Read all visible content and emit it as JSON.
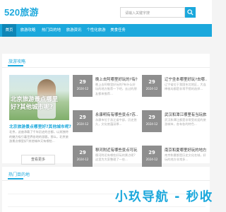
{
  "header": {
    "logo": "520旅游",
    "search_placeholder": "请输入关键字搜",
    "search_icon": "search-icon"
  },
  "nav": [
    "首页",
    "旅游攻略",
    "热门目的地",
    "旅游资讯",
    "个性化旅游",
    "美食任务"
  ],
  "section1": {
    "title": "旅游攻略",
    "feature": {
      "overlay": "北京旅游景点哪里好?其他城市呢?",
      "title": "北京旅游景点哪里好?其他城市呢?",
      "desc": "北京，这座承载了千年历史的古都，以其独特的魅力吸引着世界各地的游客。那么，北京旅游景点哪里好?其他城市又有哪些..."
    },
    "more_button": "查看更多",
    "articles": [
      {
        "day": "29",
        "ym": "2024-12",
        "title": "晚上去阿哪里好玩的?有什...",
        "desc": "晚上去阿哪里好玩的?有什么好玩的地方推荐一下吧，去过的朋友都来推荐..."
      },
      {
        "day": "29",
        "ym": "2024-12",
        "title": "辽宁坐本哪里好玩?去哪...",
        "desc": "辽宁省位于我国东北地区，大连棒槌岛都是非常不错的选择..."
      },
      {
        "day": "29",
        "ym": "2024-12",
        "title": "永康明有有哪些景点?苏...",
        "desc": "永康市位于浙江省中部，历史悠久，文化底蕴深厚..."
      },
      {
        "day": "29",
        "ym": "2024-12",
        "title": "武汉和潭江哪里有当玩旅...",
        "desc": "武汉和潭江都是非常受欢迎的旅游城市，各有各的特色..."
      },
      {
        "day": "29",
        "ym": "2024-12",
        "title": "穆河附近有哪些景点可玩...",
        "desc": "穆河附近有哪些好玩的景点呢?这里为大家整理了一些..."
      },
      {
        "day": "29",
        "ym": "2024-12",
        "title": "南京和夏哪里好玩的地方多吗...",
        "desc": "南京和夏都是历史文化名城，好玩的地方非常多..."
      }
    ]
  },
  "section2": {
    "title": "热门目的地"
  },
  "watermark": "小玖导航 - 秒收录"
}
